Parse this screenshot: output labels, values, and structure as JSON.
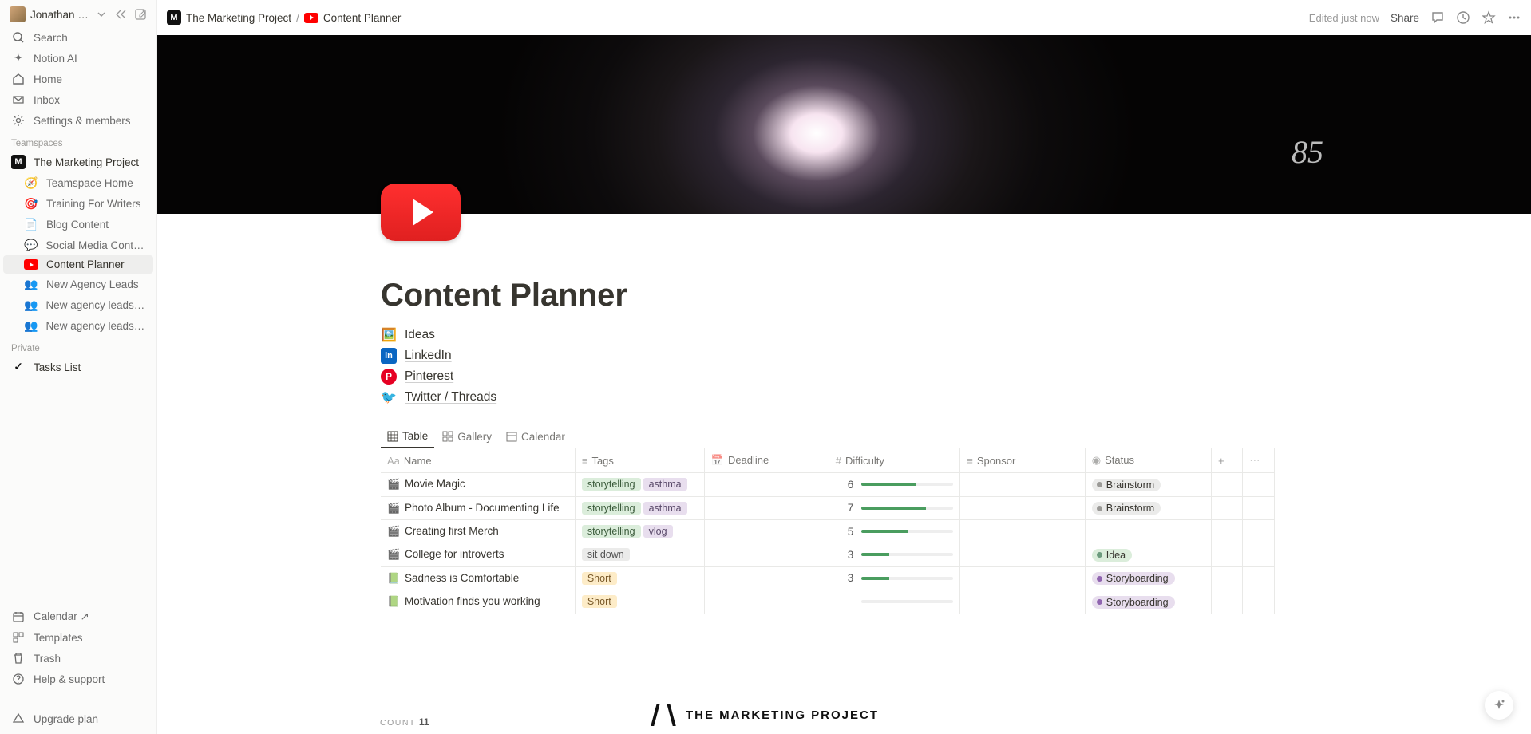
{
  "user": {
    "name": "Jonathan N..."
  },
  "sidebar": {
    "nav": [
      {
        "label": "Search"
      },
      {
        "label": "Notion AI"
      },
      {
        "label": "Home"
      },
      {
        "label": "Inbox"
      },
      {
        "label": "Settings & members"
      }
    ],
    "section1_label": "Teamspaces",
    "workspace": "The Marketing Project",
    "pages": [
      {
        "label": "Teamspace Home",
        "emoji": "🧭"
      },
      {
        "label": "Training For Writers",
        "emoji": "🎯"
      },
      {
        "label": "Blog Content",
        "emoji": "📄"
      },
      {
        "label": "Social Media Content",
        "emoji": "💬"
      },
      {
        "label": "Content Planner",
        "emoji": "▶",
        "active": true
      },
      {
        "label": "New Agency Leads",
        "emoji": "👥"
      },
      {
        "label": "New agency leads [blog...",
        "emoji": "👥"
      },
      {
        "label": "New agency leads [conte...",
        "emoji": "👥"
      }
    ],
    "section2_label": "Private",
    "private_pages": [
      {
        "label": "Tasks List",
        "emoji": "✓"
      }
    ],
    "bottom": [
      {
        "label": "Calendar ↗"
      },
      {
        "label": "Templates"
      },
      {
        "label": "Trash"
      },
      {
        "label": "Help & support"
      }
    ],
    "upgrade": "Upgrade plan"
  },
  "breadcrumb": {
    "parent": "The Marketing Project",
    "current": "Content Planner"
  },
  "topbar": {
    "edited": "Edited just now",
    "share": "Share"
  },
  "page": {
    "title": "Content Planner",
    "links": [
      {
        "label": "Ideas",
        "color": "#f0a020"
      },
      {
        "label": "LinkedIn",
        "color": "#0a66c2"
      },
      {
        "label": "Pinterest",
        "color": "#e60023"
      },
      {
        "label": "Twitter / Threads",
        "color": "#1da1f2"
      }
    ],
    "views": [
      {
        "label": "Table",
        "active": true
      },
      {
        "label": "Gallery"
      },
      {
        "label": "Calendar"
      }
    ],
    "columns": {
      "name": "Name",
      "tags": "Tags",
      "deadline": "Deadline",
      "difficulty": "Difficulty",
      "sponsor": "Sponsor",
      "status": "Status"
    },
    "rows": [
      {
        "icon": "🎬",
        "name": "Movie Magic",
        "tags": [
          {
            "t": "storytelling",
            "c": "green"
          },
          {
            "t": "asthma",
            "c": "purple"
          }
        ],
        "diff": 6,
        "status": {
          "t": "Brainstorm",
          "bg": "#ebebea",
          "dot": "#9b9a97"
        }
      },
      {
        "icon": "🎬",
        "name": "Photo Album - Documenting Life",
        "tags": [
          {
            "t": "storytelling",
            "c": "green"
          },
          {
            "t": "asthma",
            "c": "purple"
          }
        ],
        "diff": 7,
        "status": {
          "t": "Brainstorm",
          "bg": "#ebebea",
          "dot": "#9b9a97"
        }
      },
      {
        "icon": "🎬",
        "name": "Creating first Merch",
        "tags": [
          {
            "t": "storytelling",
            "c": "green"
          },
          {
            "t": "vlog",
            "c": "purple"
          }
        ],
        "diff": 5,
        "status": null
      },
      {
        "icon": "🎬",
        "name": "College for introverts",
        "tags": [
          {
            "t": "sit down",
            "c": "gray"
          }
        ],
        "diff": 3,
        "status": {
          "t": "Idea",
          "bg": "#dbeddb",
          "dot": "#6c9b7d"
        }
      },
      {
        "icon": "📗",
        "name": "Sadness is Comfortable",
        "tags": [
          {
            "t": "Short",
            "c": "yellow"
          }
        ],
        "diff": 3,
        "status": {
          "t": "Storyboarding",
          "bg": "#e8deee",
          "dot": "#9065b0"
        }
      },
      {
        "icon": "📗",
        "name": "Motivation finds you working",
        "tags": [
          {
            "t": "Short",
            "c": "yellow"
          }
        ],
        "diff": null,
        "status": {
          "t": "Storyboarding",
          "bg": "#e8deee",
          "dot": "#9065b0"
        }
      }
    ],
    "count_label": "COUNT",
    "count_value": "11"
  },
  "brand": "THE MARKETING PROJECT"
}
